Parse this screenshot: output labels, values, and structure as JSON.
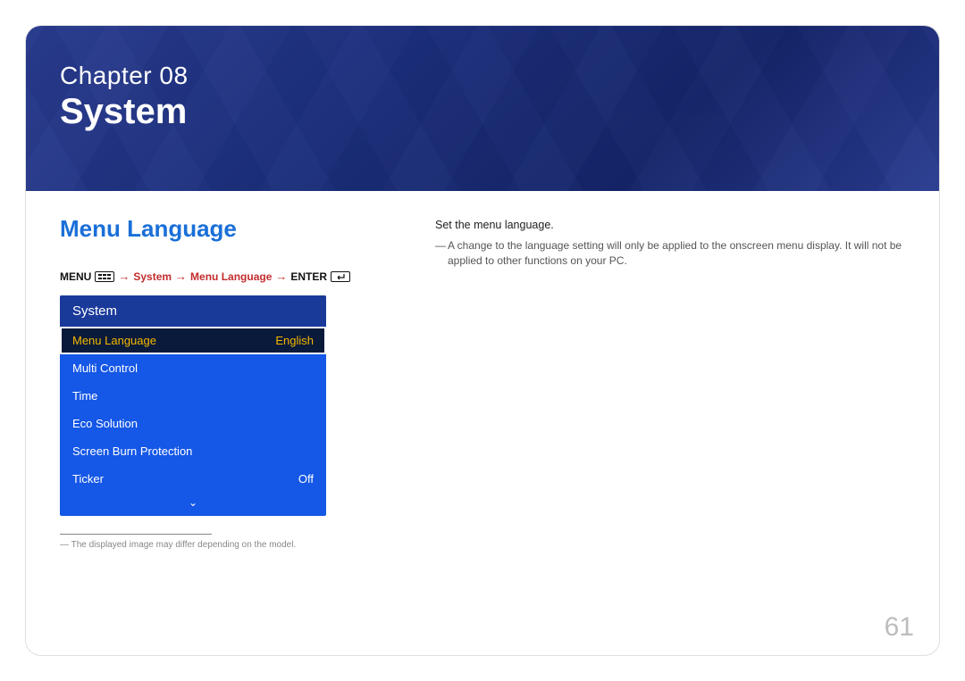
{
  "banner": {
    "chapter_label": "Chapter  08",
    "chapter_title": "System"
  },
  "section": {
    "title": "Menu Language"
  },
  "nav": {
    "menu_label": "MENU",
    "arrow": "→",
    "part1": "System",
    "part2": "Menu Language",
    "enter_label": "ENTER"
  },
  "osd": {
    "title": "System",
    "items": [
      {
        "label": "Menu Language",
        "value": "English",
        "selected": true
      },
      {
        "label": "Multi Control",
        "value": "",
        "selected": false
      },
      {
        "label": "Time",
        "value": "",
        "selected": false
      },
      {
        "label": "Eco Solution",
        "value": "",
        "selected": false
      },
      {
        "label": "Screen Burn Protection",
        "value": "",
        "selected": false
      },
      {
        "label": "Ticker",
        "value": "Off",
        "selected": false
      }
    ],
    "scroll_indicator": "⌄"
  },
  "footnote": "―  The displayed image may differ depending on the model.",
  "description": {
    "main": "Set the menu language.",
    "note": "A change to the language setting will only be applied to the onscreen menu display. It will not be applied to other functions on your PC."
  },
  "page_number": "61"
}
